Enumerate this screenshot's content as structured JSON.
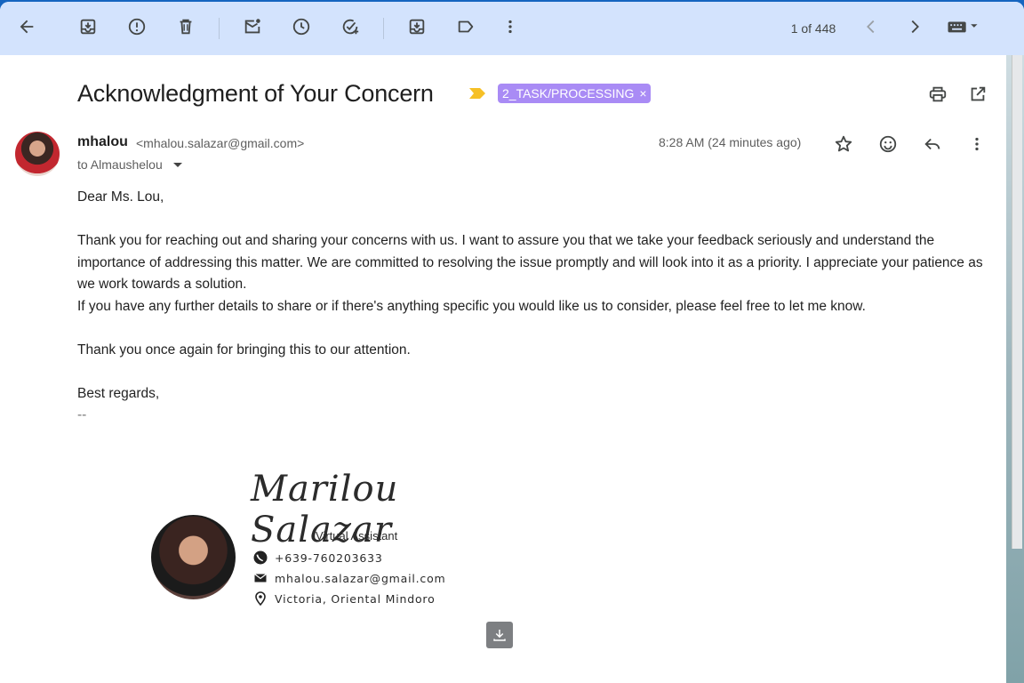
{
  "toolbar": {
    "icons": [
      "back-arrow-icon",
      "archive-icon",
      "report-spam-icon",
      "delete-icon",
      "mark-unread-icon",
      "snooze-icon",
      "add-to-tasks-icon",
      "move-to-icon",
      "label-icon",
      "more-vert-icon"
    ],
    "pager": "1 of 448"
  },
  "email": {
    "subject": "Acknowledgment of Your Concern",
    "label": "2_TASK/PROCESSING",
    "label_color": "#a98bf5",
    "sender_name": "mhalou",
    "sender_email": "<mhalou.salazar@gmail.com>",
    "to": "to Almaushelou",
    "timestamp": "8:28 AM (24 minutes ago)",
    "body": {
      "greeting": "Dear Ms. Lou,",
      "para1": "Thank you for reaching out and sharing your concerns with us. I want to assure you that we take your feedback seriously and understand the importance of addressing this matter. We are committed to resolving the issue promptly and will look into it as a priority. I appreciate your patience as we work towards a solution.",
      "para2": "If you have any further details to share or if there's anything specific you would like us to consider, please feel free to let me know.",
      "para3": "Thank you once again for bringing this to our attention.",
      "closing": "Best regards,",
      "sig_dash": "--"
    },
    "signature": {
      "name": "Marilou Salazar",
      "role": "Virtual Assistant",
      "phone": "+639-760203633",
      "email": "mhalou.salazar@gmail.com",
      "location": "Victoria, Oriental Mindoro"
    }
  }
}
